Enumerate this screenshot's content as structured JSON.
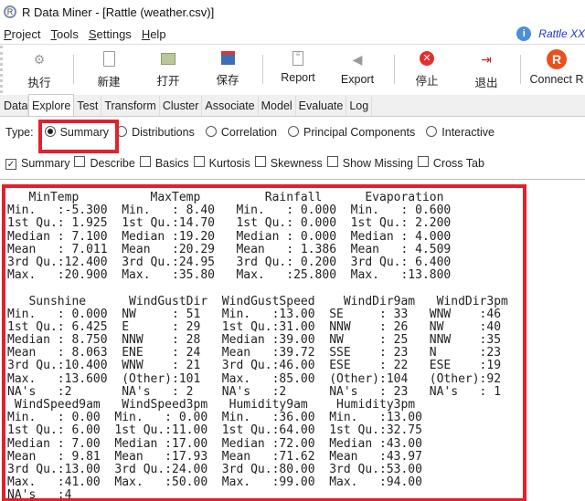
{
  "window": {
    "title": "R Data Miner - [Rattle (weather.csv)]",
    "icon": "r-logo-icon"
  },
  "menu": {
    "items": [
      {
        "label": "Project",
        "u": "P",
        "rest": "roject"
      },
      {
        "label": "Tools",
        "u": "T",
        "rest": "ools"
      },
      {
        "label": "Settings",
        "u": "S",
        "rest": "ettings"
      },
      {
        "label": "Help",
        "u": "H",
        "rest": "elp"
      }
    ],
    "about": "Rattle XX"
  },
  "toolbar": {
    "execute": "执行",
    "new": "新建",
    "open": "打开",
    "save": "保存",
    "report": "Report",
    "export": "Export",
    "stop": "停止",
    "quit": "退出",
    "connect": "Connect R"
  },
  "tabs": [
    "Data",
    "Explore",
    "Test",
    "Transform",
    "Cluster",
    "Associate",
    "Model",
    "Evaluate",
    "Log"
  ],
  "active_tab": "Explore",
  "type": {
    "label": "Type:",
    "options": [
      "Summary",
      "Distributions",
      "Correlation",
      "Principal Components",
      "Interactive"
    ],
    "selected": "Summary"
  },
  "checks": [
    {
      "label": "Summary",
      "checked": true
    },
    {
      "label": "Describe",
      "checked": false
    },
    {
      "label": "Basics",
      "checked": false
    },
    {
      "label": "Kurtosis",
      "checked": false
    },
    {
      "label": "Skewness",
      "checked": false
    },
    {
      "label": "Show Missing",
      "checked": false
    },
    {
      "label": "Cross Tab",
      "checked": false
    }
  ],
  "output": {
    "lines": [
      "   MinTemp          MaxTemp         Rainfall      Evaporation",
      "Min.   :-5.300  Min.   : 8.40   Min.   : 0.000  Min.   : 0.600",
      "1st Qu.: 1.925  1st Qu.:14.70   1st Qu.: 0.000  1st Qu.: 2.200",
      "Median : 7.100  Median :19.20   Median : 0.000  Median : 4.000",
      "Mean   : 7.011  Mean   :20.29   Mean   : 1.386  Mean   : 4.509",
      "3rd Qu.:12.400  3rd Qu.:24.95   3rd Qu.: 0.200  3rd Qu.: 6.400",
      "Max.   :20.900  Max.   :35.80   Max.   :25.800  Max.   :13.800",
      "",
      "   Sunshine      WindGustDir  WindGustSpeed    WindDir9am   WindDir3pm",
      "Min.   : 0.000  NW     : 51   Min.   :13.00  SE     : 33   WNW    :46",
      "1st Qu.: 6.425  E      : 29   1st Qu.:31.00  NNW    : 26   NW     :40",
      "Median : 8.750  NNW    : 28   Median :39.00  NW     : 25   NNW    :35",
      "Mean   : 8.063  ENE    : 24   Mean   :39.72  SSE    : 23   N      :23",
      "3rd Qu.:10.400  WNW    : 21   3rd Qu.:46.00  ESE    : 22   ESE    :19",
      "Max.   :13.600  (Other):101   Max.   :85.00  (Other):104   (Other):92",
      "NA's   :2       NA's   : 2    NA's   :2      NA's   : 23   NA's   : 1",
      " WindSpeed9am   WindSpeed3pm   Humidity9am    Humidity3pm",
      "Min.   : 0.00  Min.   : 0.00  Min.   :36.00  Min.   :13.00",
      "1st Qu.: 6.00  1st Qu.:11.00  1st Qu.:64.00  1st Qu.:32.75",
      "Median : 7.00  Median :17.00  Median :72.00  Median :43.00",
      "Mean   : 9.81  Mean   :17.93  Mean   :71.62  Mean   :43.97",
      "3rd Qu.:13.00  3rd Qu.:24.00  3rd Qu.:80.00  3rd Qu.:53.00",
      "Max.   :41.00  Max.   :50.00  Max.   :99.00  Max.   :94.00",
      "NA's   :4"
    ]
  },
  "colors": {
    "highlight": "#e3202b",
    "link": "#2233cc"
  }
}
